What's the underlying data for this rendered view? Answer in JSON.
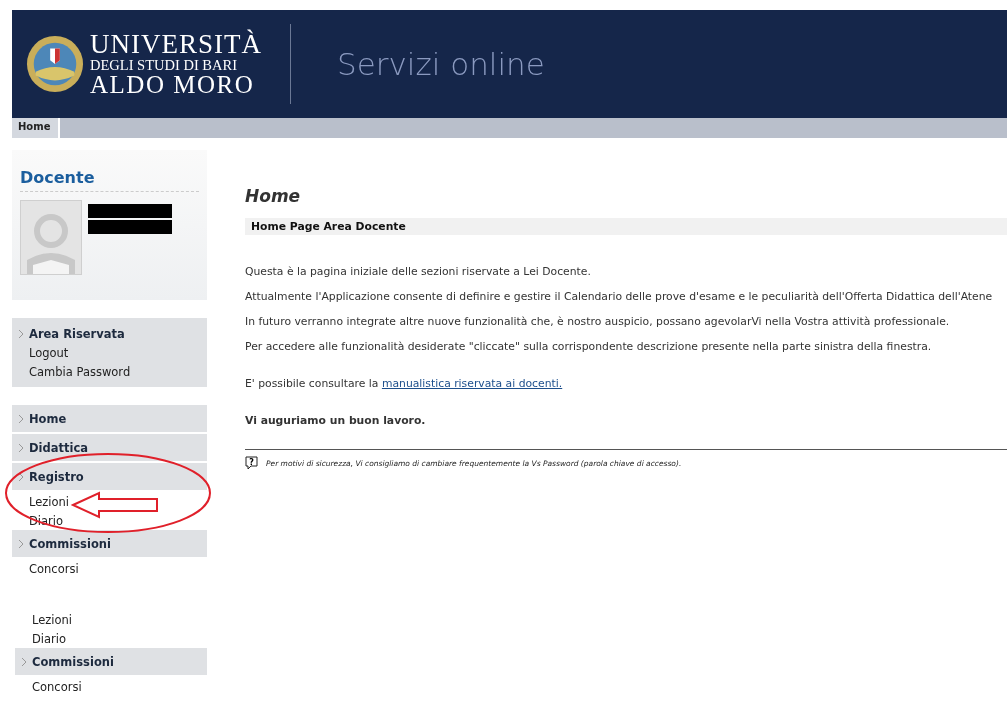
{
  "header": {
    "university_line_1": "UNIVERSITÀ",
    "university_line_2": "DEGLI STUDI DI BARI",
    "university_line_3": "ALDO MORO",
    "service_title": "Servizi online"
  },
  "breadcrumb": [
    {
      "label": "Home",
      "selected": true
    }
  ],
  "sidebar": {
    "profile_title": "Docente",
    "menus": [
      [
        {
          "kind": "header",
          "label": "Area Riservata"
        },
        {
          "kind": "link",
          "label": "Logout"
        },
        {
          "kind": "link",
          "label": "Cambia Password"
        }
      ],
      [
        {
          "kind": "header",
          "label": "Home"
        },
        {
          "kind": "header",
          "label": "Didattica"
        },
        {
          "kind": "header",
          "label": "Registro"
        },
        {
          "kind": "link",
          "label": "Lezioni"
        },
        {
          "kind": "link",
          "label": "Diario"
        },
        {
          "kind": "header",
          "label": "Commissioni"
        },
        {
          "kind": "link",
          "label": "Concorsi"
        }
      ]
    ],
    "pasted_menu": [
      {
        "kind": "link",
        "label": "Lezioni"
      },
      {
        "kind": "link",
        "label": "Diario"
      },
      {
        "kind": "header",
        "label": "Commissioni"
      },
      {
        "kind": "link",
        "label": "Concorsi"
      }
    ]
  },
  "main": {
    "title": "Home",
    "section_title": "Home Page Area Docente",
    "paragraphs": [
      "Questa è la pagina iniziale delle sezioni riservate a Lei Docente.",
      "Attualmente l'Applicazione consente di definire e gestire il Calendario delle prove d'esame e le peculiarità dell'Offerta Didattica dell'Atene",
      "In futuro verranno integrate altre nuove funzionalità che, è nostro auspicio, possano agevolarVi nella Vostra attività professionale.",
      "Per accedere alle funzionalità desiderate \"cliccate\" sulla corrispondente descrizione presente nella parte sinistra della finestra."
    ],
    "manual_text": "E' possibile consultare la",
    "manual_link": "manualistica riservata ai docenti.",
    "closing": "Vi auguriamo un buon lavoro.",
    "help_glyph": "?",
    "security_note": "Per motivi di sicurezza, Vi consigliamo di cambiare frequentemente la Vs Password (parola chiave di accesso)."
  }
}
